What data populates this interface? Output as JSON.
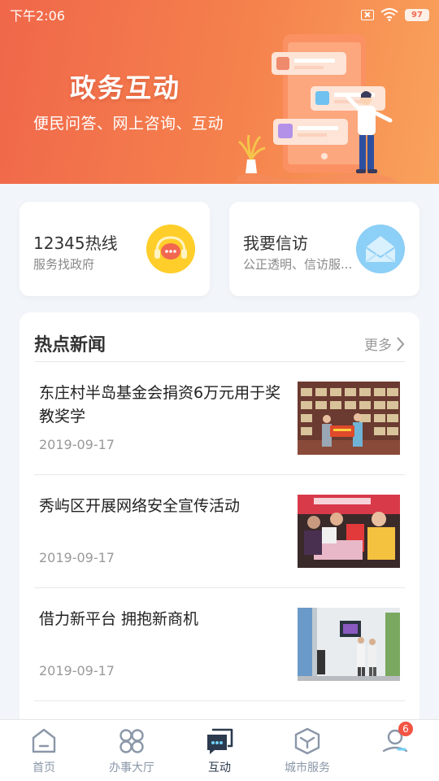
{
  "status_bar": {
    "time": "下午2:06",
    "battery": "97"
  },
  "banner": {
    "title": "政务互动",
    "subtitle": "便民问答、网上咨询、互动"
  },
  "quick_cards": [
    {
      "title": "12345热线",
      "subtitle": "服务找政府",
      "icon": "chat-bubble-icon"
    },
    {
      "title": "我要信访",
      "subtitle": "公正透明、信访服...",
      "icon": "envelope-icon"
    }
  ],
  "news": {
    "heading": "热点新闻",
    "more_label": "更多",
    "items": [
      {
        "title": "东庄村半岛基金会捐资6万元用于奖教奖学",
        "date": "2019-09-17"
      },
      {
        "title": "秀屿区开展网络安全宣传活动",
        "date": "2019-09-17"
      },
      {
        "title": "借力新平台 拥抱新商机",
        "date": "2019-09-17"
      }
    ]
  },
  "tabs": [
    {
      "label": "首页",
      "icon": "home-icon"
    },
    {
      "label": "办事大厅",
      "icon": "grid-icon"
    },
    {
      "label": "互动",
      "icon": "chat-icon"
    },
    {
      "label": "城市服务",
      "icon": "cube-icon"
    },
    {
      "label": "",
      "icon": "user-icon",
      "badge": "6"
    }
  ],
  "colors": {
    "banner_start": "#f0674a",
    "banner_end": "#f9a25c",
    "active_tab": "#2b3a4e",
    "badge": "#f25444"
  }
}
